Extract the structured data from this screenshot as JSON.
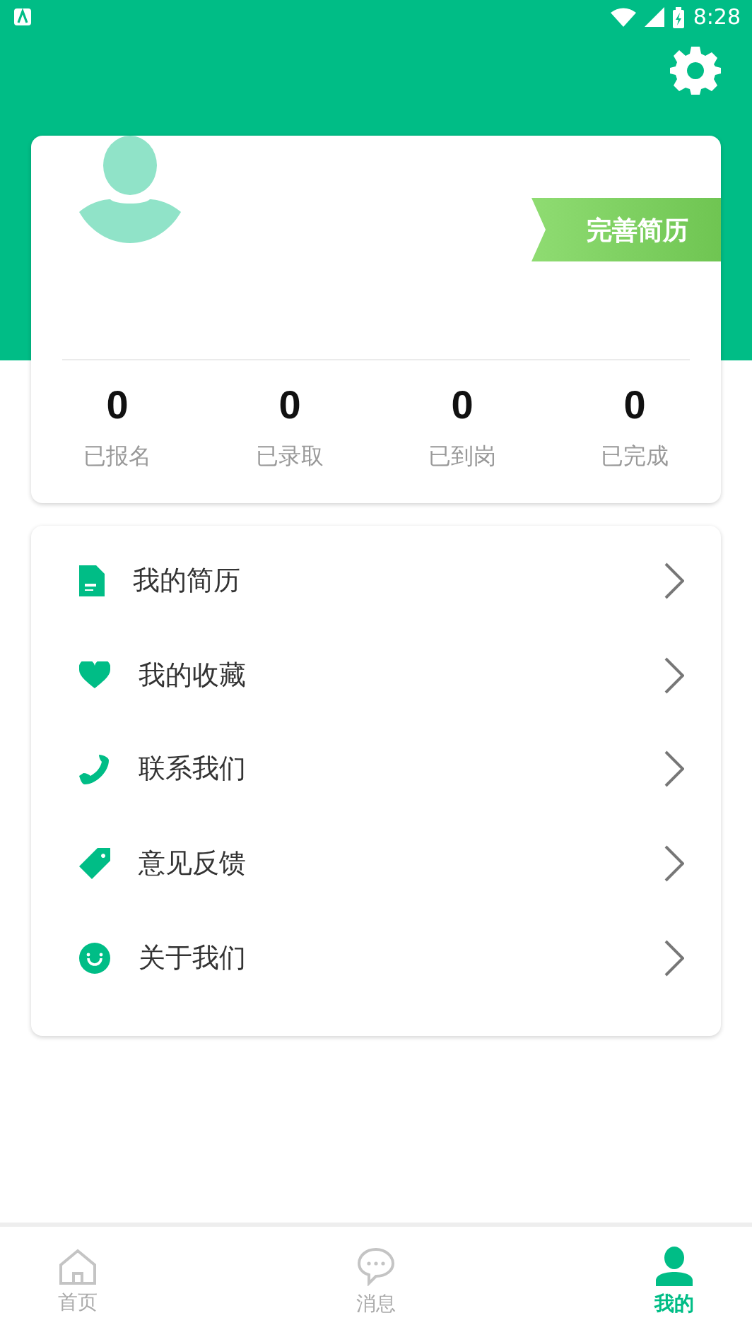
{
  "status_bar": {
    "time": "8:28"
  },
  "profile": {
    "action": "完善简历",
    "stats": [
      {
        "value": "0",
        "label": "已报名"
      },
      {
        "value": "0",
        "label": "已录取"
      },
      {
        "value": "0",
        "label": "已到岗"
      },
      {
        "value": "0",
        "label": "已完成"
      }
    ]
  },
  "menu": [
    {
      "label": "我的简历"
    },
    {
      "label": "我的收藏"
    },
    {
      "label": "联系我们"
    },
    {
      "label": "意见反馈"
    },
    {
      "label": "关于我们"
    }
  ],
  "tabs": [
    {
      "label": "首页",
      "selected": false
    },
    {
      "label": "消息",
      "selected": false
    },
    {
      "label": "我的",
      "selected": true
    }
  ]
}
